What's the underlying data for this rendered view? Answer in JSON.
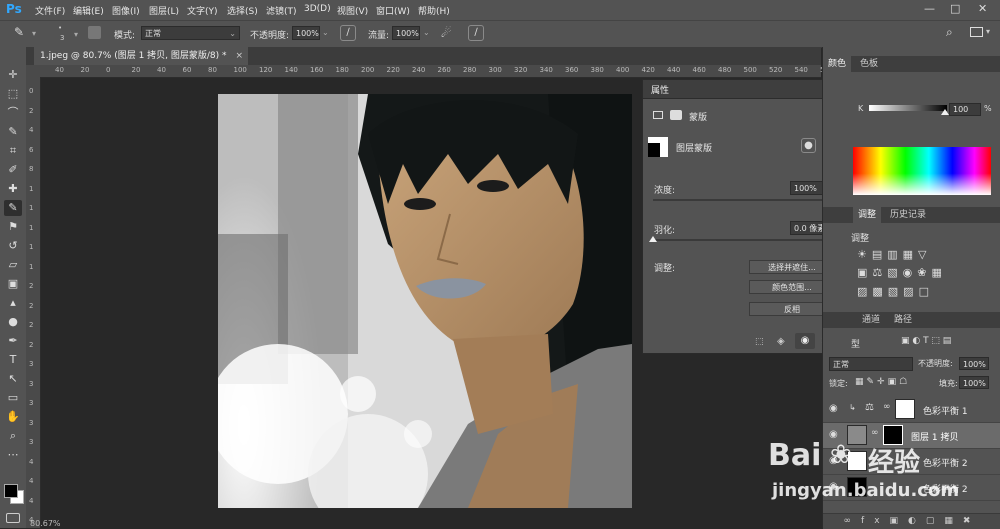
{
  "menu": {
    "logo": "Ps",
    "items": [
      "文件(F)",
      "编辑(E)",
      "图像(I)",
      "图层(L)",
      "文字(Y)",
      "选择(S)",
      "滤镜(T)",
      "3D(D)",
      "视图(V)",
      "窗口(W)",
      "帮助(H)"
    ]
  },
  "options": {
    "brush_size": "3",
    "mode_label": "模式:",
    "mode_value": "正常",
    "opacity_label": "不透明度:",
    "opacity_value": "100%",
    "flow_label": "流量:",
    "flow_value": "100%"
  },
  "document": {
    "tab_title": "1.jpeg @ 80.7% (图层 1 拷贝, 图层蒙版/8) *",
    "zoom_status": "80.67%"
  },
  "ruler": {
    "h_ticks": [
      "40",
      "20",
      "0",
      "20",
      "40",
      "60",
      "80",
      "100",
      "120",
      "140",
      "160",
      "180",
      "200",
      "220",
      "240",
      "260",
      "280",
      "300",
      "320",
      "340",
      "360",
      "380",
      "400",
      "420",
      "440",
      "460",
      "480",
      "500",
      "520",
      "540",
      "560"
    ],
    "v_ticks": [
      "0",
      "2",
      "4",
      "6",
      "8",
      "1",
      "1",
      "1",
      "1",
      "1",
      "2",
      "2",
      "2",
      "2",
      "3",
      "3",
      "3",
      "3",
      "3",
      "4",
      "4",
      "4",
      "4"
    ]
  },
  "properties": {
    "title": "属性",
    "section_label": "蒙版",
    "layer_mask_label": "图层蒙版",
    "density_label": "浓度:",
    "density_value": "100%",
    "feather_label": "羽化:",
    "feather_value": "0.0 像素",
    "adjust_label": "调整:",
    "btn_select_mask": "选择并遮住...",
    "btn_color_range": "颜色范围...",
    "btn_invert": "反相",
    "density_level": 1.0,
    "feather_level": 0.0
  },
  "right_panel": {
    "color_tabs": [
      "颜色",
      "色板"
    ],
    "k_label": "K",
    "k_value": "100",
    "adjust_tabs": [
      "调整",
      "历史记录"
    ],
    "adjust_title": "调整",
    "layer_tabs": [
      "通道",
      "路径"
    ],
    "filter_label": "型",
    "blend_mode": "正常",
    "opacity_label": "不透明度:",
    "opacity_value": "100%",
    "lock_label": "锁定:",
    "fill_label": "填充:",
    "fill_value": "100%",
    "layers": [
      {
        "name": "色彩平衡 1"
      },
      {
        "name": "图层 1 拷贝"
      },
      {
        "name": "色彩平衡 2"
      },
      {
        "name": "色彩平衡 2"
      }
    ]
  },
  "watermark": {
    "brand": "Bai",
    "brand_cn": "经验",
    "url": "jingyan.baidu.com"
  },
  "colors": {
    "accent": "#31a8ff",
    "ui_dark": "#282828",
    "ui_mid": "#535353"
  }
}
